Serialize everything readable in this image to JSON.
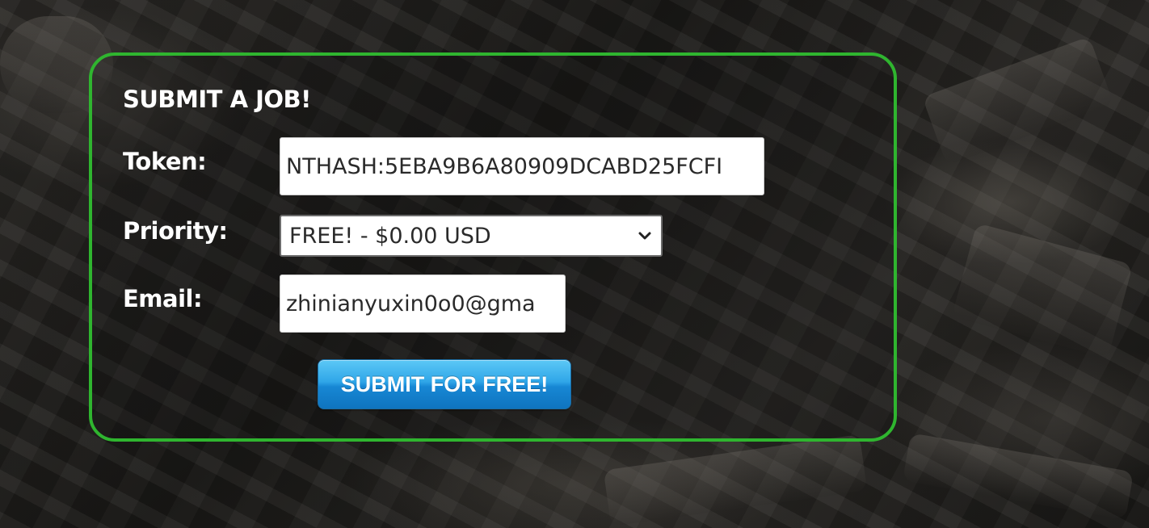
{
  "form": {
    "heading": "SUBMIT A JOB!",
    "token": {
      "label": "Token:",
      "value": "NTHASH:5EBA9B6A80909DCABD25FCFI"
    },
    "priority": {
      "label": "Priority:",
      "selected": "FREE! - $0.00 USD"
    },
    "email": {
      "label": "Email:",
      "value": "zhinianyuxin0o0@gma"
    },
    "submit_label": "SUBMIT FOR FREE!"
  },
  "colors": {
    "panel_border": "#2fb52f",
    "button_blue": "#1787d4",
    "label_text": "#ffffff"
  },
  "icons": {
    "select_arrow": "chevron-down-icon"
  }
}
